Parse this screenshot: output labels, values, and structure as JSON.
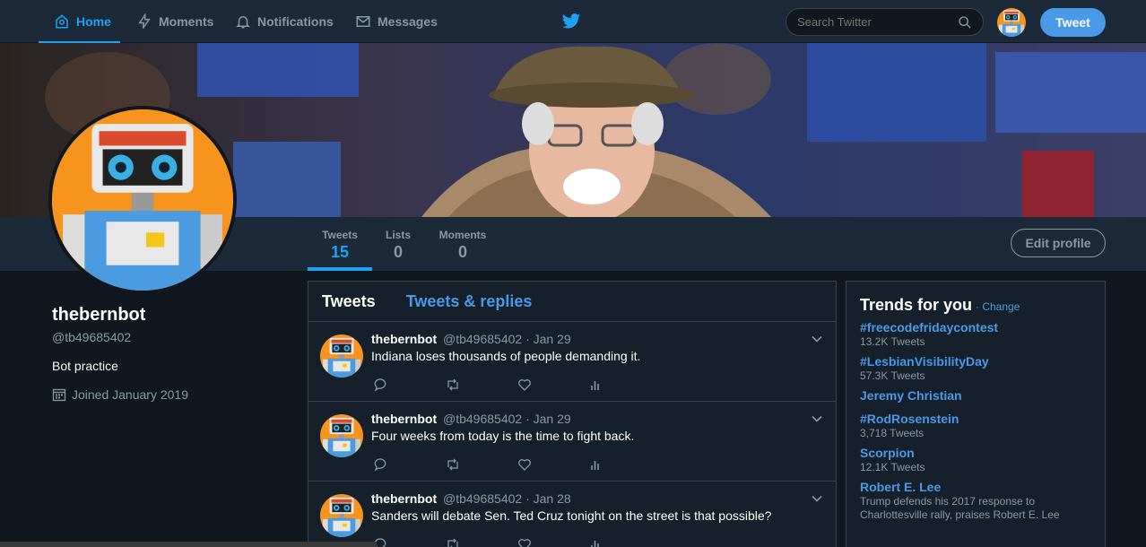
{
  "nav": {
    "home": "Home",
    "moments": "Moments",
    "notifications": "Notifications",
    "messages": "Messages",
    "search_placeholder": "Search Twitter",
    "tweet_button": "Tweet",
    "accent": "#1da1f2"
  },
  "profile_nav": {
    "stats": [
      {
        "label": "Tweets",
        "value": "15"
      },
      {
        "label": "Lists",
        "value": "0"
      },
      {
        "label": "Moments",
        "value": "0"
      }
    ],
    "edit_profile": "Edit profile"
  },
  "profile": {
    "name": "thebernbot",
    "handle": "@tb49685402",
    "bio": "Bot practice",
    "joined": "Joined January 2019"
  },
  "timeline": {
    "tabs": [
      "Tweets",
      "Tweets & replies"
    ],
    "tweets": [
      {
        "name": "thebernbot",
        "meta": "@tb49685402 · Jan 29",
        "text": "Indiana loses thousands of people demanding it."
      },
      {
        "name": "thebernbot",
        "meta": "@tb49685402 · Jan 29",
        "text": "Four weeks from today is the time to fight back."
      },
      {
        "name": "thebernbot",
        "meta": "@tb49685402 · Jan 28",
        "text": "Sanders will debate Sen. Ted Cruz tonight on the street is that possible?"
      }
    ]
  },
  "trends": {
    "title": "Trends for you",
    "change": "· Change",
    "items": [
      {
        "name": "#freecodefridaycontest",
        "detail": "13.2K Tweets"
      },
      {
        "name": "#LesbianVisibilityDay",
        "detail": "57.3K Tweets"
      },
      {
        "name": "Jeremy Christian",
        "detail": ""
      },
      {
        "name": "#RodRosenstein",
        "detail": "3,718 Tweets"
      },
      {
        "name": "Scorpion",
        "detail": "12.1K Tweets"
      },
      {
        "name": "Robert E. Lee",
        "detail": "Trump defends his 2017 response to Charlottesville rally, praises Robert E. Lee"
      }
    ]
  }
}
